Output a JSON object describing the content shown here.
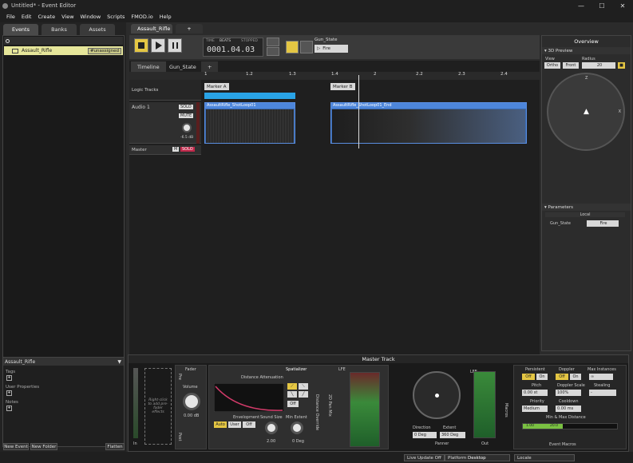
{
  "window": {
    "title": "Untitled* - Event Editor",
    "controls": [
      "—",
      "☐",
      "✕"
    ]
  },
  "menu": [
    "File",
    "Edit",
    "Create",
    "View",
    "Window",
    "Scripts",
    "FMOD.io",
    "Help"
  ],
  "left": {
    "tabs": [
      "Events",
      "Banks",
      "Assets"
    ],
    "event_name": "Assault_Rifle",
    "event_badge": "#unassigned",
    "detail_title": "Assault_Rifle",
    "props": [
      "Tags",
      "User Properties",
      "Notes"
    ],
    "plus": "+",
    "buttons": [
      "New Event",
      "New Folder",
      "Flatten"
    ]
  },
  "editor": {
    "tab": "Assault_Rifle",
    "tab_plus": "+",
    "time_labels": [
      "TIME",
      "BEATS",
      "STOPPED"
    ],
    "time": "0001.04.03",
    "game_state_label": "Gun_State",
    "game_state_value": "Fire",
    "view_tabs": [
      "Timeline",
      "Gun_State",
      "+"
    ],
    "ruler_ticks": [
      "1",
      "1.2",
      "1.3",
      "1.4",
      "2",
      "2.2",
      "2.3",
      "2.4"
    ],
    "logic_tracks": "Logic Tracks",
    "markers": [
      "Marker A",
      "Marker B"
    ],
    "track": {
      "name": "Audio 1",
      "solo": "SOLO",
      "mute": "MUTE",
      "volume": "-6.5 dB"
    },
    "master": {
      "name": "Master",
      "m": "M",
      "solo": "SOLO"
    },
    "clips": [
      "AssaultRifle_ShotLoop01",
      "AssaultRifle_ShotLoop01_End"
    ]
  },
  "overview": {
    "title": "Overview",
    "preview": "3D Preview",
    "view_label": "View",
    "radius_label": "Radius",
    "view_buttons": [
      "Ortho",
      "Front"
    ],
    "radius": "20",
    "compass": {
      "z": "Z",
      "x": "X"
    },
    "parameters": "Parameters",
    "local": "Local",
    "param_name": "Gun_State",
    "param_value": "Fire"
  },
  "deck": {
    "title": "Master Track",
    "fader": "Fader",
    "pre_fader_note": "Right-click to add pre-fader effects",
    "in": "In",
    "pre": "Pre",
    "post": "Post",
    "volume_label": "Volume",
    "volume": "0.00 dB",
    "spatializer": "Spatializer",
    "distance_atten": "Distance Attenuation",
    "envelopment": "Envelopment",
    "env_buttons": [
      "Auto",
      "User",
      "Off"
    ],
    "sound_size": "Sound Size",
    "sound_size_val": "2.00",
    "min_extent": "Min Extent",
    "min_extent_val": "0 Deg",
    "off": "Off",
    "distance_override": "Distance Override",
    "pan_mix": "2D Pan Mix",
    "lfe": "LFE",
    "direction": "Direction",
    "direction_val": "0 Deg",
    "extent": "Extent",
    "extent_val": "360 Deg",
    "panner": "Panner",
    "out": "Out",
    "macros": "Macros",
    "persistent": "Persistent",
    "doppler": "Doppler",
    "max_instances": "Max Instances",
    "off_on": [
      "Off",
      "On"
    ],
    "max_val": "∞",
    "pitch": "Pitch",
    "pitch_val": "0.00 st",
    "doppler_scale": "Doppler Scale",
    "doppler_scale_val": "100%",
    "stealing": "Stealing",
    "stealing_val": "-",
    "priority": "Priority",
    "priority_val": "Medium",
    "cooldown": "Cooldown",
    "cooldown_val": "0.00 ms",
    "minmax": "Min & Max Distance",
    "minmax_vals": [
      "1.00",
      "20.0"
    ],
    "event_macros": "Event Macros"
  },
  "status": {
    "live": "Live Update Off",
    "platform_label": "Platform",
    "platform": "Desktop",
    "locale": "Locale"
  },
  "colors": {
    "accent": "#e4c643",
    "clip": "#3a6ab0",
    "event_row": "#e6e69a",
    "solo": "#c0284a"
  }
}
